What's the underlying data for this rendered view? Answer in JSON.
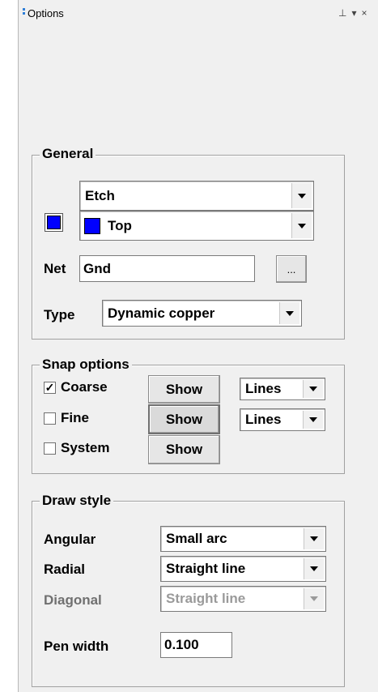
{
  "window": {
    "title": "Options"
  },
  "general": {
    "title": "General",
    "class_value": "Etch",
    "subclass_value": "Top",
    "subclass_color": "#0000ff",
    "net_label": "Net",
    "net_value": "Gnd",
    "net_browse_label": "...",
    "type_label": "Type",
    "type_value": "Dynamic copper"
  },
  "snap": {
    "title": "Snap options",
    "rows": [
      {
        "label": "Coarse",
        "checked": true,
        "check_mark": "✓",
        "button": "Show",
        "mode": "Lines"
      },
      {
        "label": "Fine",
        "checked": false,
        "check_mark": "",
        "button": "Show",
        "mode": "Lines"
      },
      {
        "label": "System",
        "checked": false,
        "check_mark": "",
        "button": "Show"
      }
    ]
  },
  "draw_style": {
    "title": "Draw style",
    "angular_label": "Angular",
    "angular_value": "Small arc",
    "radial_label": "Radial",
    "radial_value": "Straight line",
    "diagonal_label": "Diagonal",
    "diagonal_value": "Straight line",
    "pen_width_label": "Pen width",
    "pen_width_value": "0.100"
  }
}
